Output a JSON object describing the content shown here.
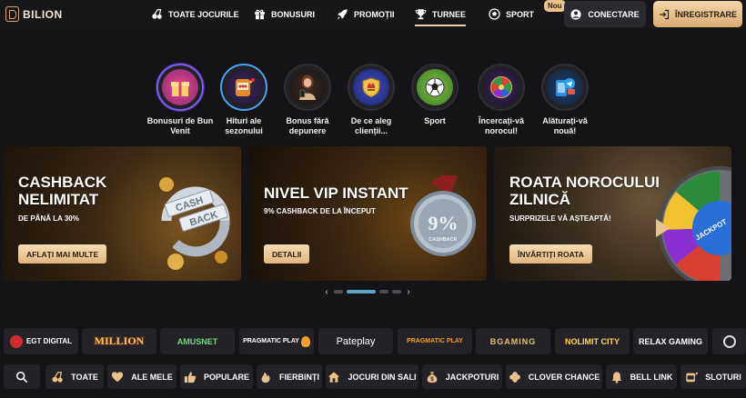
{
  "brand": {
    "name": "BILION"
  },
  "nav": [
    {
      "label": "TOATE JOCURILE",
      "icon": "cherries-icon"
    },
    {
      "label": "BONUSURI",
      "icon": "gift-icon"
    },
    {
      "label": "PROMOȚII",
      "icon": "rocket-icon"
    },
    {
      "label": "TURNEE",
      "icon": "trophy-icon",
      "active": true
    },
    {
      "label": "SPORT",
      "icon": "soccer-ball-icon",
      "badge": "Nou"
    }
  ],
  "auth": {
    "login": "CONECTARE",
    "register": "ÎNREGISTRARE"
  },
  "categories": [
    {
      "label": "Bonusuri de Bun Venit",
      "icon": "gift-box-icon"
    },
    {
      "label": "Hituri ale sezonului",
      "icon": "slot-machine-icon"
    },
    {
      "label": "Bonus fără depunere",
      "icon": "woman-with-phone-icon"
    },
    {
      "label": "De ce aleg clienții...",
      "icon": "shield-badge-icon"
    },
    {
      "label": "Sport",
      "icon": "soccer-ball-icon"
    },
    {
      "label": "Încercați-vă norocul!",
      "icon": "wheel-of-fortune-icon"
    },
    {
      "label": "Alăturați-vă nouă!",
      "icon": "telegram-phone-icon"
    }
  ],
  "promos": [
    {
      "title_line1": "CASHBACK",
      "title_line2": "NELIMITAT",
      "subtitle": "DE PÂNĂ LA 30%",
      "button": "AFLAȚI MAI MULTE",
      "art_text_1": "CASH",
      "art_text_2": "BACK"
    },
    {
      "title_line1": "NIVEL VIP INSTANT",
      "subtitle": "9% CASHBACK DE LA ÎNCEPUT",
      "button": "DETALII",
      "art_text_1": "9%",
      "art_text_2": "CASHBACK"
    },
    {
      "title_line1": "ROATA NOROCULUI",
      "title_line2": "ZILNICĂ",
      "subtitle": "SURPRIZELE VĂ AȘTEAPTĂ!",
      "button": "ÎNVÂRTIȚI ROATA",
      "art_text_1": "JACKPOT"
    }
  ],
  "pager": {
    "count": 5,
    "active": 1
  },
  "providers": [
    {
      "label": "EGT DIGITAL",
      "color": "#ffffff"
    },
    {
      "label": "MILLION",
      "color": "#f1c94b"
    },
    {
      "label": "AMUSNET",
      "color": "#7ed18b"
    },
    {
      "label": "PRAGMATIC PLAY",
      "color": "#ffffff"
    },
    {
      "label": "Pateplay",
      "color": "#ffffff"
    },
    {
      "label": "PRAGMATIC PLAY",
      "color": "#f0a030"
    },
    {
      "label": "BGAMING",
      "color": "#e0c07a"
    },
    {
      "label": "NOLIMIT CITY",
      "color": "#ffd64a"
    },
    {
      "label": "RELAX GAMING",
      "color": "#ffffff"
    }
  ],
  "filters": [
    {
      "label": "",
      "icon": "search-icon"
    },
    {
      "label": "TOATE",
      "icon": "cherries-icon"
    },
    {
      "label": "ALE MELE",
      "icon": "heart-icon"
    },
    {
      "label": "POPULARE",
      "icon": "thumbs-up-icon"
    },
    {
      "label": "FIERBINȚI",
      "icon": "flame-icon"
    },
    {
      "label": "JOCURI DIN SALI",
      "icon": "house-icon"
    },
    {
      "label": "JACKPOTURI",
      "icon": "money-bag-icon"
    },
    {
      "label": "CLOVER CHANCE",
      "icon": "clover-icon"
    },
    {
      "label": "BELL LINK",
      "icon": "bell-icon"
    },
    {
      "label": "SLOTURI",
      "icon": "slot-icon"
    }
  ],
  "colors": {
    "accent": "#e9c28c",
    "background": "#141416",
    "card": "#232327",
    "pager_active": "#5fa3c7"
  }
}
